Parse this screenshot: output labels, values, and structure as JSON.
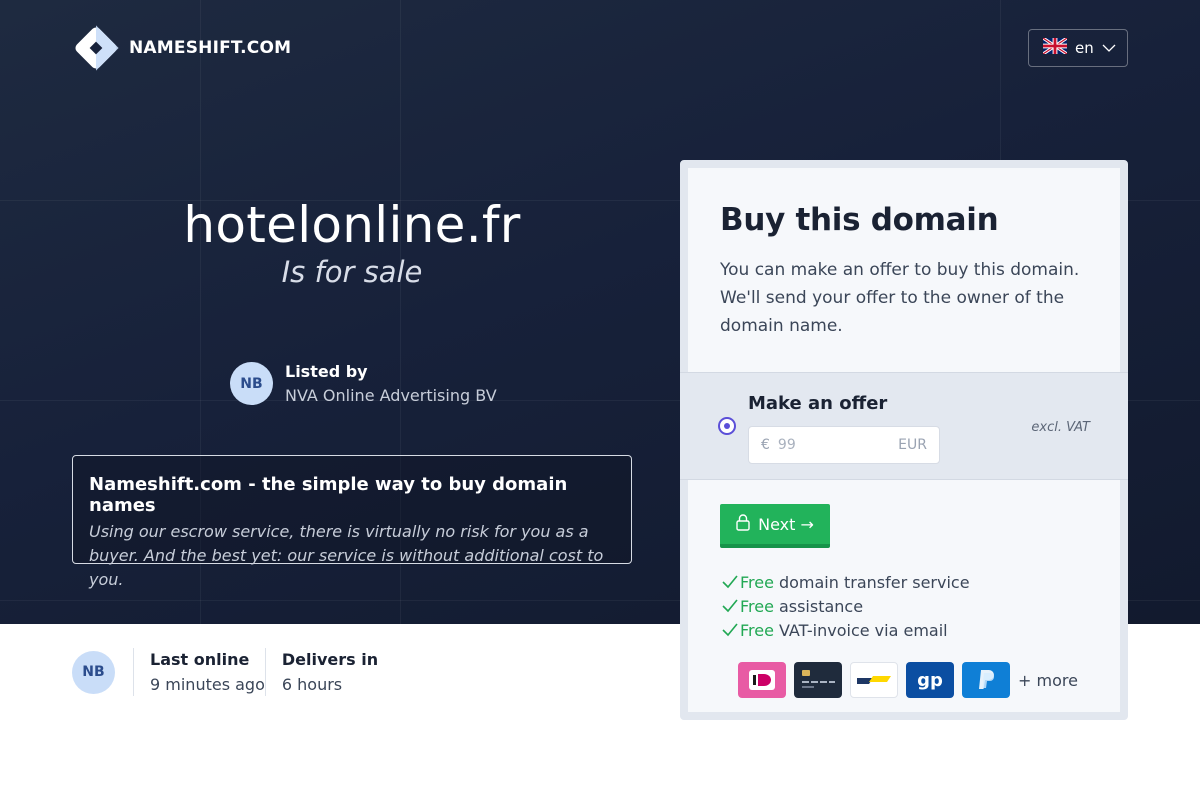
{
  "brand": {
    "name": "NAMESHIFT.COM"
  },
  "language": {
    "code": "en",
    "flag": "uk-flag-icon"
  },
  "hero": {
    "domain": "hotelonline.fr",
    "subtitle": "Is for sale"
  },
  "seller": {
    "initials": "NB",
    "listed_by_label": "Listed by",
    "name": "NVA Online Advertising BV"
  },
  "info": {
    "title": "Nameshift.com - the simple way to buy domain names",
    "description": "Using our escrow service, there is virtually no risk for you as a buyer. And the best yet: our service is without additional cost to you."
  },
  "stats": {
    "initials": "NB",
    "last_online_label": "Last online",
    "last_online_value": "9 minutes ago",
    "delivers_label": "Delivers in",
    "delivers_value": "6 hours"
  },
  "buy": {
    "title": "Buy this domain",
    "description": "You can make an offer to buy this domain. We'll send your offer to the owner of the domain name.",
    "offer_label": "Make an offer",
    "currency_symbol": "€",
    "offer_placeholder": "99",
    "currency_code": "EUR",
    "vat_note": "excl. VAT",
    "next_label": "Next →",
    "perks": [
      {
        "free": "Free",
        "text": "domain transfer service"
      },
      {
        "free": "Free",
        "text": "assistance"
      },
      {
        "free": "Free",
        "text": "VAT-invoice via email"
      }
    ],
    "payment_methods": [
      "ideal-icon",
      "credit-card-icon",
      "bancontact-icon",
      "giropay-icon",
      "paypal-icon"
    ],
    "more_label": "+ more"
  },
  "colors": {
    "hero_bg": "#17213a",
    "accent_green": "#22b35b",
    "radio_accent": "#5b4fd8",
    "avatar_bg": "#c9ddf8"
  }
}
